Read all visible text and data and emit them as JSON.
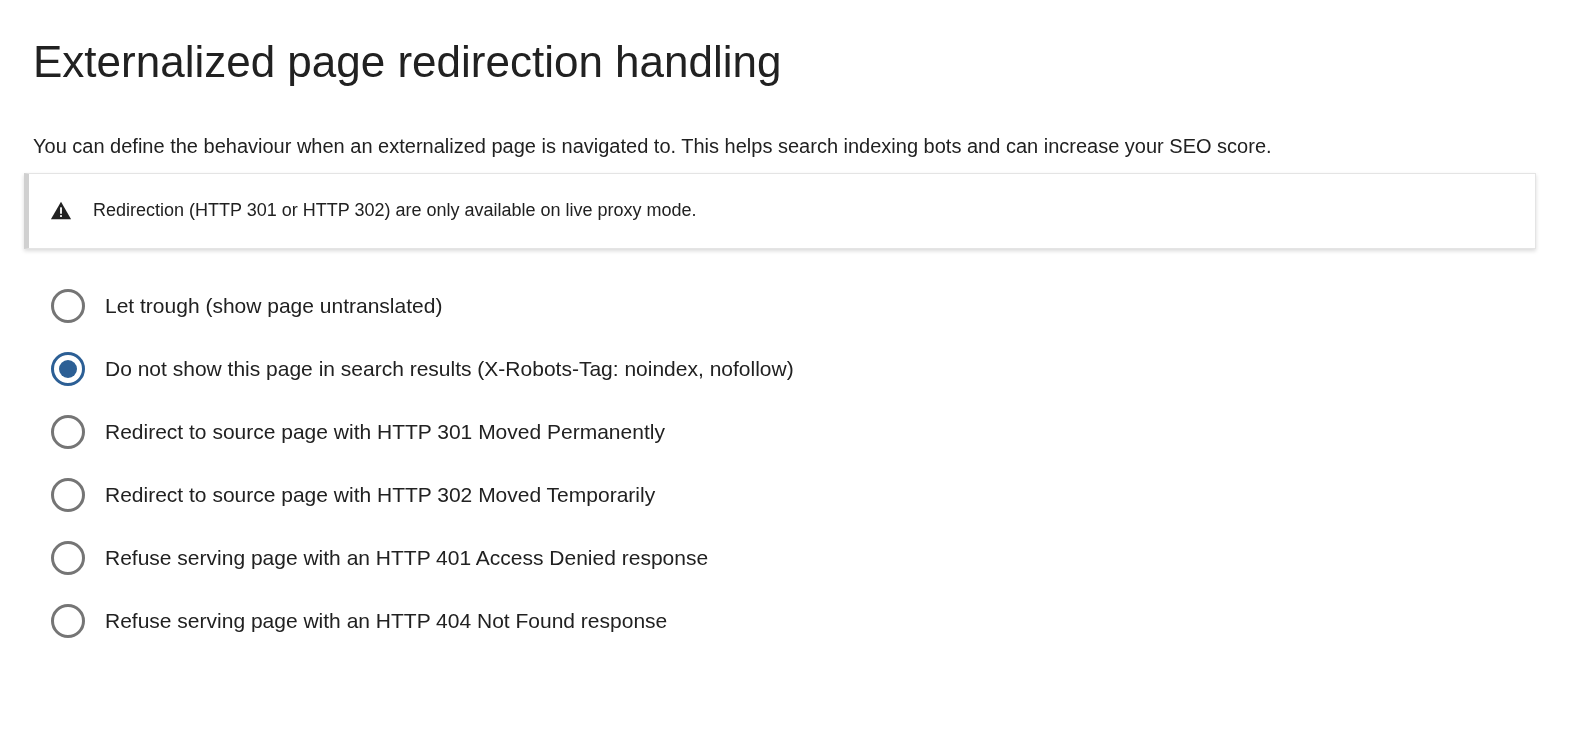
{
  "title": "Externalized page redirection handling",
  "description": "You can define the behaviour when an externalized page is navigated to. This helps search indexing bots and can increase your SEO score.",
  "alert": {
    "text": "Redirection (HTTP 301 or HTTP 302) are only available on live proxy mode."
  },
  "options": [
    {
      "label": "Let trough (show page untranslated)",
      "selected": false
    },
    {
      "label": "Do not show this page in search results (X-Robots-Tag: noindex, nofollow)",
      "selected": true
    },
    {
      "label": "Redirect to source page with HTTP 301 Moved Permanently",
      "selected": false
    },
    {
      "label": "Redirect to source page with HTTP 302 Moved Temporarily",
      "selected": false
    },
    {
      "label": "Refuse serving page with an HTTP 401 Access Denied response",
      "selected": false
    },
    {
      "label": "Refuse serving page with an HTTP 404 Not Found response",
      "selected": false
    }
  ]
}
